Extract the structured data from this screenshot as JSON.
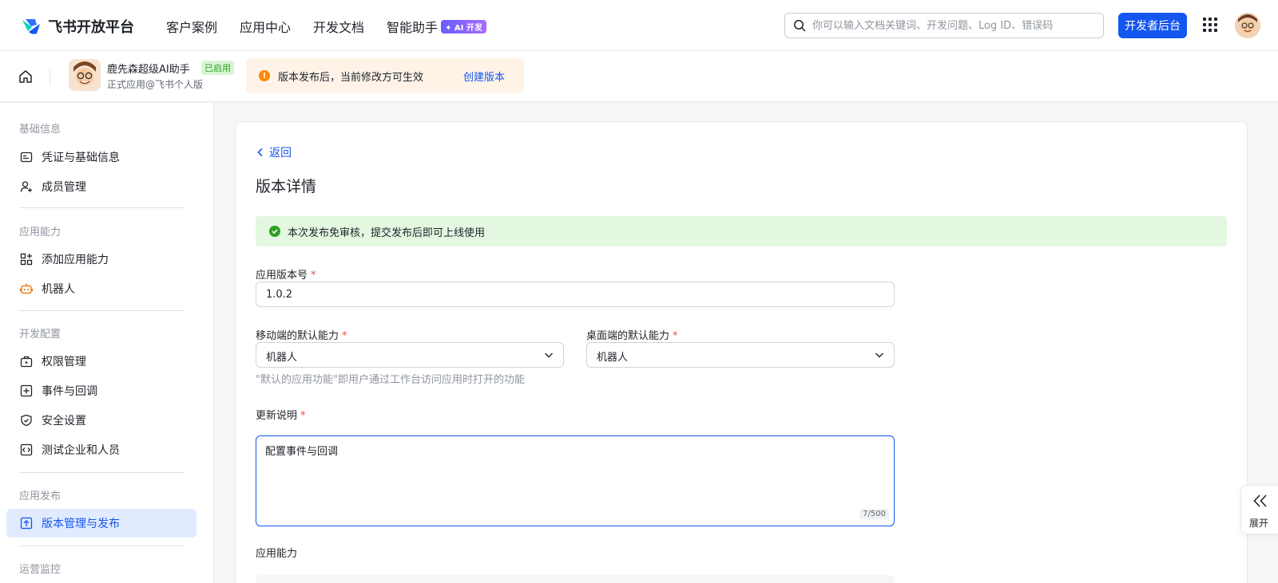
{
  "topbar": {
    "brand": "飞书开放平台",
    "nav": [
      "客户案例",
      "应用中心",
      "开发文档",
      "智能助手"
    ],
    "ai_badge": "✦ AI 开发",
    "search_placeholder": "你可以输入文档关键词、开发问题、Log ID、错误码",
    "dev_button": "开发者后台"
  },
  "app": {
    "name": "鹿先森超级AI助手",
    "status": "已启用",
    "subtitle": "正式应用@飞书个人版"
  },
  "notice": {
    "icon": "!",
    "text": "版本发布后，当前修改方可生效",
    "link": "创建版本"
  },
  "sidebar": {
    "sections": [
      {
        "title": "基础信息",
        "items": [
          "凭证与基础信息",
          "成员管理"
        ]
      },
      {
        "title": "应用能力",
        "items": [
          "添加应用能力",
          "机器人"
        ]
      },
      {
        "title": "开发配置",
        "items": [
          "权限管理",
          "事件与回调",
          "安全设置",
          "测试企业和人员"
        ]
      },
      {
        "title": "应用发布",
        "items": [
          "版本管理与发布"
        ]
      },
      {
        "title": "运营监控",
        "items": []
      }
    ]
  },
  "main": {
    "back": "返回",
    "title": "版本详情",
    "success": "本次发布免审核，提交发布后即可上线使用",
    "version_label": "应用版本号",
    "version_value": "1.0.2",
    "mobile_label": "移动端的默认能力",
    "mobile_value": "机器人",
    "desktop_label": "桌面端的默认能力",
    "desktop_value": "机器人",
    "default_hint": "\"默认的应用功能\"即用户通过工作台访问应用时打开的功能",
    "notes_label": "更新说明",
    "notes_value": "配置事件与回调",
    "notes_counter": "7/500",
    "capability_label": "应用能力",
    "required_mark": "*"
  },
  "expand": {
    "label": "展开"
  },
  "colors": {
    "accent": "#1456f0",
    "success": "#2ea121",
    "warning": "#ff8800",
    "required": "#f54a45"
  }
}
